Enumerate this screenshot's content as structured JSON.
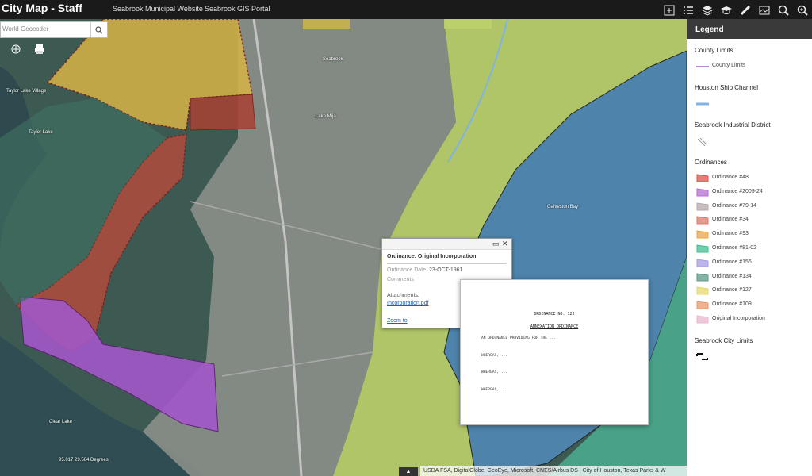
{
  "header": {
    "title": "City Map - Staff",
    "links": [
      "Seabrook Municipal Website",
      "Seabrook GIS Portal"
    ]
  },
  "toolbar": [
    "plus-square-icon",
    "list-icon",
    "layers-icon",
    "graduation-cap-icon",
    "ruler-icon",
    "basemap-icon",
    "zoom-icon",
    "search-map-icon"
  ],
  "search": {
    "placeholder": "World Geocoder"
  },
  "map": {
    "labels": [
      "Seabrook",
      "Lake Mija",
      "Taylor Lake",
      "Clear Lake",
      "Galveston Bay",
      "Taylor Lake Village",
      "Seabrook"
    ],
    "coordinates": "95.017 29.584 Degrees",
    "attribution": "USDA FSA, DigitalGlobe, GeoEye, Microsoft, CNES/Airbus DS | City of Houston, Texas Parks & W"
  },
  "popup": {
    "title": "Ordinance: Original Incorporation",
    "date_label": "Ordinance Date",
    "date_value": "23-OCT-1961",
    "comments_label": "Comments",
    "attachments_label": "Attachments:",
    "attachment_link": "Incorporation.pdf",
    "zoom_link": "Zoom to"
  },
  "document": {
    "heading": "ORDINANCE NO. 122",
    "subheading": "ANNEXATION ORDINANCE",
    "lines": [
      "AN ORDINANCE PROVIDING FOR THE ...",
      "WHEREAS, ...",
      "WHEREAS, ...",
      "WHEREAS, ..."
    ]
  },
  "legend": {
    "title": "Legend",
    "county_limits": {
      "group": "County Limits",
      "item": "County Limits",
      "color": "#b48ad0"
    },
    "ship_channel": {
      "group": "Houston Ship Channel",
      "color": "#7fb3e6"
    },
    "industrial": {
      "group": "Seabrook Industrial District"
    },
    "ordinances_group": "Ordinances",
    "ordinances": [
      {
        "label": "Ordinance #48",
        "color": "#d9534f"
      },
      {
        "label": "Ordinance #2009-24",
        "color": "#b06fd0"
      },
      {
        "label": "Ordinance #79-14",
        "color": "#b7a8a8"
      },
      {
        "label": "Ordinance #34",
        "color": "#d97a6a"
      },
      {
        "label": "Ordinance #93",
        "color": "#e8a64a"
      },
      {
        "label": "Ordinance #81-02",
        "color": "#3fbf8f"
      },
      {
        "label": "Ordinance #156",
        "color": "#a59ee0"
      },
      {
        "label": "Ordinance #134",
        "color": "#5f9a8a"
      },
      {
        "label": "Ordinance #127",
        "color": "#e6d86a"
      },
      {
        "label": "Ordinance #109",
        "color": "#e99a6a"
      },
      {
        "label": "Original Incorporation",
        "color": "#e9b6cf"
      }
    ],
    "city_limits": {
      "group": "Seabrook City Limits"
    }
  }
}
